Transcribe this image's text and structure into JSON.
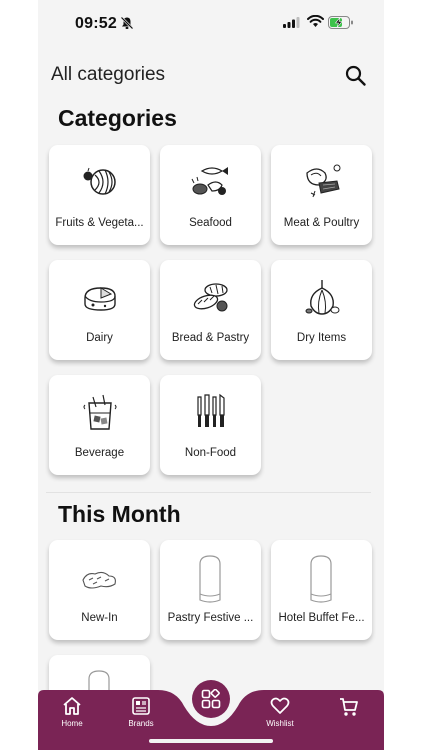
{
  "status_bar": {
    "time": "09:52"
  },
  "app_bar": {
    "title": "All categories",
    "search_icon": "search-icon"
  },
  "categories": {
    "heading": "Categories",
    "items": [
      {
        "label": "Fruits & Vegeta...",
        "icon": "fruit-icon"
      },
      {
        "label": "Seafood",
        "icon": "seafood-icon"
      },
      {
        "label": "Meat & Poultry",
        "icon": "meat-icon"
      },
      {
        "label": "Dairy",
        "icon": "cheese-icon"
      },
      {
        "label": "Bread & Pastry",
        "icon": "bread-icon"
      },
      {
        "label": "Dry Items",
        "icon": "garlic-icon"
      },
      {
        "label": "Beverage",
        "icon": "beverage-icon"
      },
      {
        "label": "Non-Food",
        "icon": "knives-icon"
      }
    ]
  },
  "this_month": {
    "heading": "This Month",
    "items": [
      {
        "label": "New-In",
        "icon": "new-in-icon"
      },
      {
        "label": "Pastry Festive ...",
        "icon": "chef-hat-icon"
      },
      {
        "label": "Hotel Buffet Fe...",
        "icon": "chef-hat-icon"
      }
    ]
  },
  "bottom_nav": {
    "home": "Home",
    "brands": "Brands",
    "wishlist": "Wishlist"
  },
  "colors": {
    "brand": "#7a2455",
    "background": "#f4f4f4",
    "card": "#ffffff"
  }
}
